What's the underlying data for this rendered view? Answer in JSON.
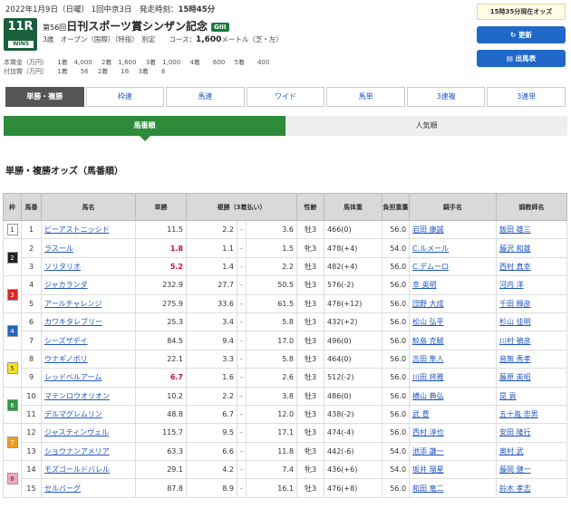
{
  "header": {
    "date_line": "2022年1月9日（日曜） 1回中京3日　発走時刻：",
    "start_time": "15時45分",
    "race_number": "11R",
    "wins_badge": "WIN5",
    "race_ordinal": "第56回",
    "race_name": "日刊スポーツ賞シンザン記念",
    "grade": "GIII",
    "conditions": "3歳　オープン（国際）（特指）　別定　　コース：",
    "distance": "1,600",
    "course_suffix": "メートル（芝・左）",
    "prize_label": "本賞金（万円）",
    "prize_values": [
      "1着　4,000",
      "2着　1,600",
      "3着　1,000",
      "4着　　600",
      "5着　　400"
    ],
    "addl_label": "付加賞（万円）",
    "addl_values": [
      "1着　　56",
      "2着　　16",
      "3着　　8"
    ]
  },
  "right_panel": {
    "odds_time": "15時35分現在オッズ",
    "refresh_label": "更新",
    "runners_label": "出馬表"
  },
  "bet_tabs": [
    "単勝・複勝",
    "枠連",
    "馬連",
    "ワイド",
    "馬単",
    "3連複",
    "3連単"
  ],
  "sort_tabs": {
    "by_number": "馬番順",
    "by_popularity": "人気順"
  },
  "section_title": "単勝・複勝オッズ（馬番順）",
  "table": {
    "headers": [
      "枠",
      "馬番",
      "馬名",
      "単勝",
      "複勝（3着払い）",
      "性齢",
      "馬体重",
      "負担重量",
      "騎手名",
      "調教師名"
    ],
    "rows": [
      {
        "waku": "1",
        "num": "1",
        "horse": "ビーアストニッシド",
        "win": "11.5",
        "plo": "2.2",
        "phi": "3.6",
        "sex": "牡3",
        "weight": "466(0)",
        "load": "56.0",
        "jockey": "岩田 康誠",
        "trainer": "飯田 雄三"
      },
      {
        "waku": "2",
        "num": "2",
        "horse": "ラスール",
        "win": "1.8",
        "plo": "1.1",
        "phi": "1.5",
        "sex": "牝3",
        "weight": "478(+4)",
        "load": "54.0",
        "jockey": "C.ルメール",
        "trainer": "藤沢 和雄"
      },
      {
        "waku": "",
        "num": "3",
        "horse": "ソリタリオ",
        "win": "5.2",
        "plo": "1.4",
        "phi": "2.2",
        "sex": "牡3",
        "weight": "482(+4)",
        "load": "56.0",
        "jockey": "C.デムーロ",
        "trainer": "西村 真幸"
      },
      {
        "waku": "3",
        "num": "4",
        "horse": "ジャカランダ",
        "win": "232.9",
        "plo": "27.7",
        "phi": "50.5",
        "sex": "牡3",
        "weight": "576(-2)",
        "load": "56.0",
        "jockey": "幸 英明",
        "trainer": "河内 洋"
      },
      {
        "waku": "",
        "num": "5",
        "horse": "アールチャレンジ",
        "win": "275.9",
        "plo": "33.6",
        "phi": "61.5",
        "sex": "牡3",
        "weight": "476(+12)",
        "load": "56.0",
        "jockey": "団野 大成",
        "trainer": "千田 輝彦"
      },
      {
        "waku": "4",
        "num": "6",
        "horse": "カワキタレブリー",
        "win": "25.3",
        "plo": "3.4",
        "phi": "5.8",
        "sex": "牡3",
        "weight": "432(+2)",
        "load": "56.0",
        "jockey": "松山 弘平",
        "trainer": "杉山 佳明"
      },
      {
        "waku": "",
        "num": "7",
        "horse": "シーズザデイ",
        "win": "84.5",
        "plo": "9.4",
        "phi": "17.0",
        "sex": "牡3",
        "weight": "496(0)",
        "load": "56.0",
        "jockey": "鮫島 克駿",
        "trainer": "川村 禎彦"
      },
      {
        "waku": "5",
        "num": "8",
        "horse": "ウナギノボリ",
        "win": "22.1",
        "plo": "3.3",
        "phi": "5.8",
        "sex": "牡3",
        "weight": "464(0)",
        "load": "56.0",
        "jockey": "吉田 隼人",
        "trainer": "音無 秀孝"
      },
      {
        "waku": "",
        "num": "9",
        "horse": "レッドベルアーム",
        "win": "6.7",
        "plo": "1.6",
        "phi": "2.6",
        "sex": "牡3",
        "weight": "512(-2)",
        "load": "56.0",
        "jockey": "川田 将雅",
        "trainer": "藤原 英昭"
      },
      {
        "waku": "6",
        "num": "10",
        "horse": "マテンロウオリオン",
        "win": "10.2",
        "plo": "2.2",
        "phi": "3.8",
        "sex": "牡3",
        "weight": "486(0)",
        "load": "56.0",
        "jockey": "横山 典弘",
        "trainer": "昆 貢"
      },
      {
        "waku": "",
        "num": "11",
        "horse": "デルマグレムリン",
        "win": "48.8",
        "plo": "6.7",
        "phi": "12.0",
        "sex": "牡3",
        "weight": "438(-2)",
        "load": "56.0",
        "jockey": "武 豊",
        "trainer": "五十嵐 忠男"
      },
      {
        "waku": "7",
        "num": "12",
        "horse": "ジャスティンヴェル",
        "win": "115.7",
        "plo": "9.5",
        "phi": "17.1",
        "sex": "牡3",
        "weight": "474(-4)",
        "load": "56.0",
        "jockey": "西村 淳也",
        "trainer": "安田 隆行"
      },
      {
        "waku": "",
        "num": "13",
        "horse": "ショウナンアメリア",
        "win": "63.3",
        "plo": "6.6",
        "phi": "11.8",
        "sex": "牝3",
        "weight": "442(-6)",
        "load": "54.0",
        "jockey": "池添 謙一",
        "trainer": "奥村 武"
      },
      {
        "waku": "8",
        "num": "14",
        "horse": "モズゴールドバレル",
        "win": "29.1",
        "plo": "4.2",
        "phi": "7.4",
        "sex": "牝3",
        "weight": "436(+6)",
        "load": "54.0",
        "jockey": "坂井 瑠星",
        "trainer": "藤岡 健一"
      },
      {
        "waku": "",
        "num": "15",
        "horse": "セルバーグ",
        "win": "87.8",
        "plo": "8.9",
        "phi": "16.1",
        "sex": "牡3",
        "weight": "476(+8)",
        "load": "56.0",
        "jockey": "和田 竜二",
        "trainer": "鈴木 孝志"
      }
    ]
  },
  "waku_colors": {
    "1": "#ffffff",
    "2": "#222222",
    "3": "#e02424",
    "4": "#2264c0",
    "5": "#f7e11c",
    "6": "#2a9a3c",
    "7": "#f39c1b",
    "8": "#f3a6c0"
  },
  "waku_text_colors": {
    "1": "#333333",
    "2": "#ffffff",
    "3": "#ffffff",
    "4": "#ffffff",
    "5": "#333333",
    "6": "#ffffff",
    "7": "#ffffff",
    "8": "#333333"
  }
}
